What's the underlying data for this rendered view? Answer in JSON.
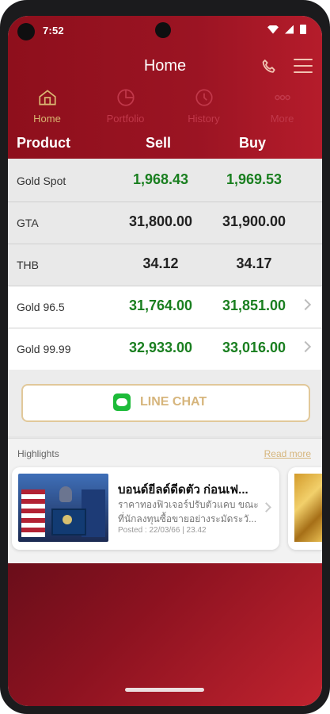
{
  "status": {
    "time": "7:52"
  },
  "app": {
    "title": "Home"
  },
  "nav": [
    {
      "label": "Home",
      "icon": "home-icon",
      "active": true
    },
    {
      "label": "Portfolio",
      "icon": "portfolio-icon",
      "active": false
    },
    {
      "label": "History",
      "icon": "history-icon",
      "active": false
    },
    {
      "label": "More",
      "icon": "more-icon",
      "active": false
    }
  ],
  "table": {
    "headers": {
      "product": "Product",
      "sell": "Sell",
      "buy": "Buy"
    },
    "rows": [
      {
        "name": "Gold Spot",
        "sell": "1,968.43",
        "buy": "1,969.53"
      },
      {
        "name": "GTA",
        "sell": "31,800.00",
        "buy": "31,900.00"
      },
      {
        "name": "THB",
        "sell": "34.12",
        "buy": "34.17"
      },
      {
        "name": "Gold 96.5",
        "sell": "31,764.00",
        "buy": "31,851.00"
      },
      {
        "name": "Gold 99.99",
        "sell": "32,933.00",
        "buy": "33,016.00"
      }
    ]
  },
  "chat": {
    "label": "LINE CHAT"
  },
  "highlights": {
    "title": "Highlights",
    "read_more": "Read more",
    "card": {
      "title": "บอนด์ยีลด์ดีดตัว ก่อนเฟ...",
      "line1": "ราคาทองฟิวเจอร์ปรับตัวแคบ ขณะ",
      "line2": "ที่นักลงทุนซื้อขายอย่างระมัดระวั...",
      "posted": "Posted : 22/03/66 | 23.42"
    }
  },
  "colors": {
    "brand": "#8e0f1c",
    "accent_gold": "#d6b57c",
    "price_green": "#1a7f20"
  }
}
